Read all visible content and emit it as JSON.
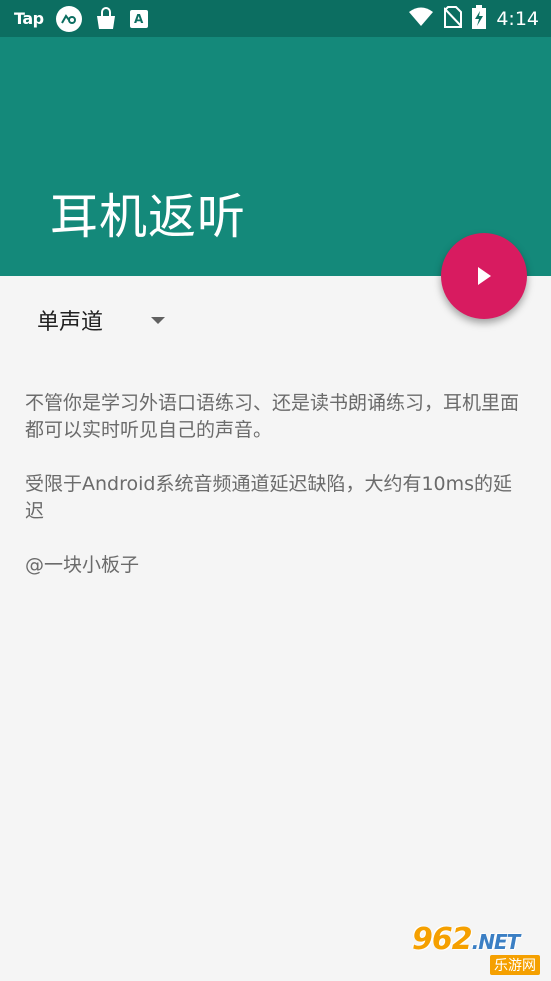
{
  "status_bar": {
    "tap_label": "Tap",
    "time": "4:14",
    "icons": [
      "tap-icon",
      "link-icon",
      "bag-icon",
      "a-icon",
      "wifi-icon",
      "no-sim-icon",
      "battery-charging-icon"
    ]
  },
  "app_bar": {
    "title": "耳机返听",
    "color": "#14897a",
    "status_color": "#0c6e61"
  },
  "fab": {
    "icon": "play-icon",
    "color": "#d81b60"
  },
  "spinner": {
    "selected": "单声道"
  },
  "description": {
    "para1": "不管你是学习外语口语练习、还是读书朗诵练习，耳机里面都可以实时听见自己的声音。",
    "para2": " 受限于Android系统音频通道延迟缺陷，大约有10ms的延迟",
    "para3": " @一块小板子"
  },
  "watermark": {
    "brand": "962",
    "suffix": ".NET",
    "sub": "乐游网"
  }
}
